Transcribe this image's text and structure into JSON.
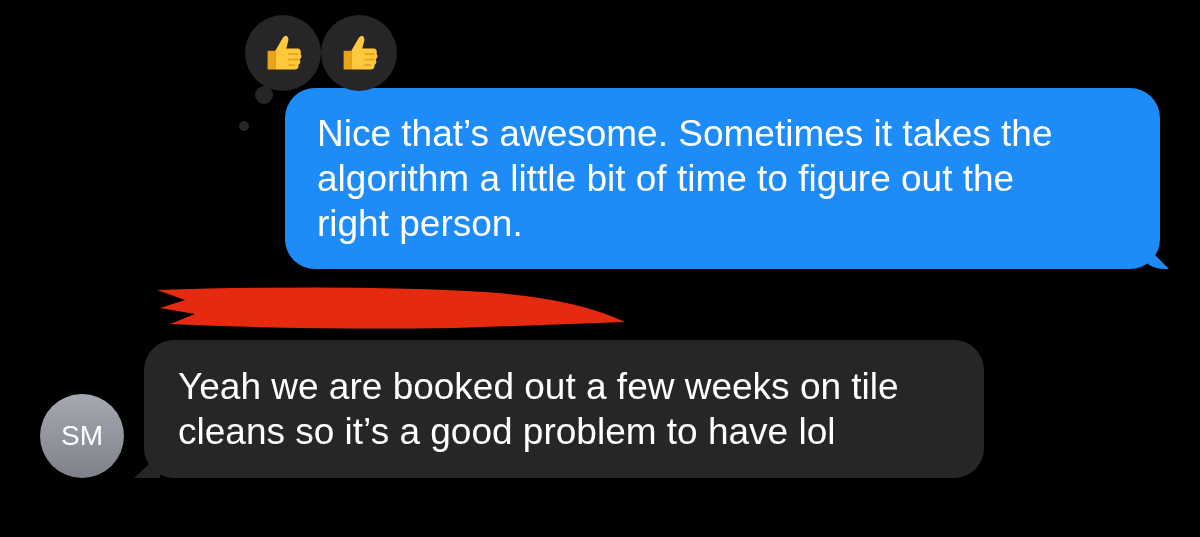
{
  "messages": [
    {
      "kind": "outgoing",
      "text": "Nice that’s awesome. Sometimes it takes the algorithm a little bit of time to figure out the right person.",
      "reactions": [
        {
          "kind": "thumbs_up"
        },
        {
          "kind": "thumbs_up"
        }
      ]
    },
    {
      "kind": "incoming",
      "sender_name": {
        "redacted": true
      },
      "avatar": "SM",
      "text": "Yeah we are booked out a few weeks on tile cleans so it’s a good problem to have lol"
    }
  ]
}
